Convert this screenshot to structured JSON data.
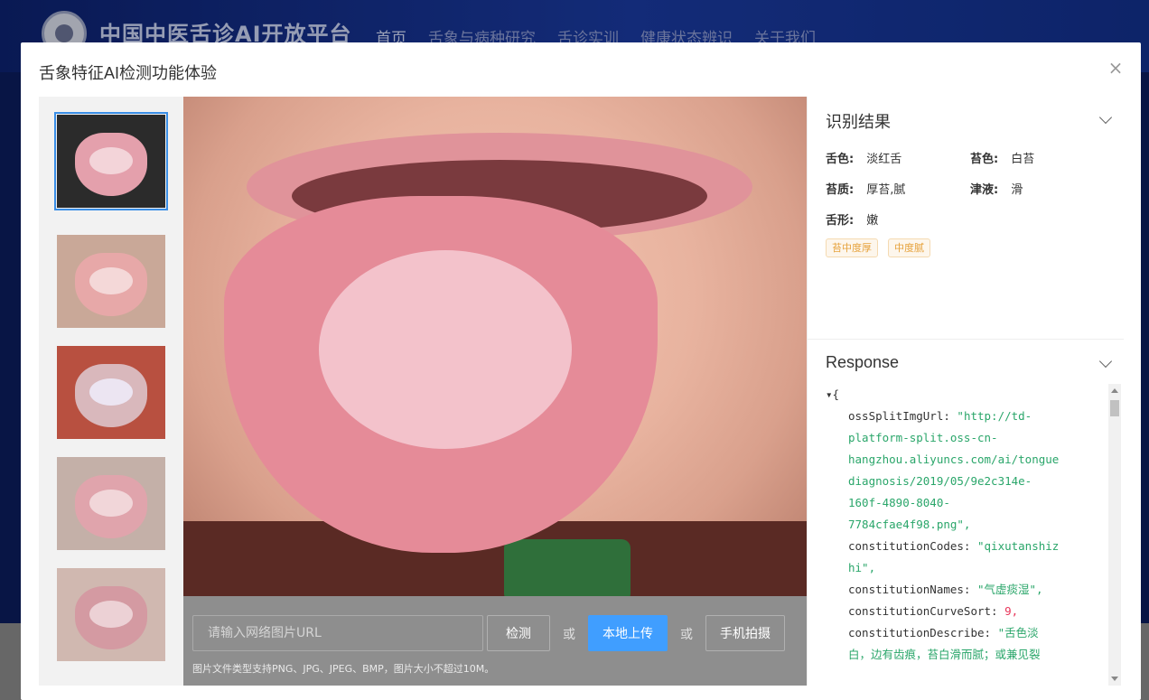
{
  "site": {
    "title": "中国中医舌诊AI开放平台",
    "nav": [
      "首页",
      "舌象与病种研究",
      "舌诊实训",
      "健康状态辨识",
      "关于我们"
    ]
  },
  "modal": {
    "title": "舌象特征AI检测功能体验",
    "close_icon": "close-icon"
  },
  "thumbnails": [
    {
      "label": "thumb-1",
      "selected": true
    },
    {
      "label": "thumb-2",
      "selected": false
    },
    {
      "label": "thumb-3",
      "selected": false
    },
    {
      "label": "thumb-4",
      "selected": false
    },
    {
      "label": "thumb-5",
      "selected": false
    }
  ],
  "controls": {
    "url_placeholder": "请输入网络图片URL",
    "detect_label": "检测",
    "or1": "或",
    "upload_label": "本地上传",
    "or2": "或",
    "phone_label": "手机拍摄",
    "hint": "图片文件类型支持PNG、JPG、JPEG、BMP，图片大小不超过10M。"
  },
  "result": {
    "header": "识别结果",
    "tongue_color_key": "舌色:",
    "tongue_color_val": "淡红舌",
    "coat_color_key": "苔色:",
    "coat_color_val": "白苔",
    "coat_quality_key": "苔质:",
    "coat_quality_val": "厚苔,腻",
    "fluid_key": "津液:",
    "fluid_val": "滑",
    "shape_key": "舌形:",
    "shape_val": "嫩",
    "tags": [
      "苔中度厚",
      "中度腻"
    ]
  },
  "response": {
    "header": "Response",
    "json_lines": [
      {
        "k": "",
        "v": "{",
        "t": "brace"
      },
      {
        "k": "ossSplitImgUrl",
        "v": "\"http://td-",
        "t": "str"
      },
      {
        "k": "",
        "v": "platform-split.oss-cn-",
        "t": "str"
      },
      {
        "k": "",
        "v": "hangzhou.aliyuncs.com/ai/tongue",
        "t": "str"
      },
      {
        "k": "",
        "v": "diagnosis/2019/05/9e2c314e-",
        "t": "str"
      },
      {
        "k": "",
        "v": "160f-4890-8040-",
        "t": "str"
      },
      {
        "k": "",
        "v": "7784cfae4f98.png\",",
        "t": "str"
      },
      {
        "k": "constitutionCodes",
        "v": "\"qixutanshiz",
        "t": "str"
      },
      {
        "k": "",
        "v": "hi\",",
        "t": "str"
      },
      {
        "k": "constitutionNames",
        "v": "\"气虚痰湿\",",
        "t": "str"
      },
      {
        "k": "constitutionCurveSort",
        "v": "9,",
        "t": "num"
      },
      {
        "k": "constitutionDescribe",
        "v": "\"舌色淡",
        "t": "str"
      },
      {
        "k": "",
        "v": "白，边有齿痕，苔白滑而腻；或兼见裂",
        "t": "str"
      }
    ]
  }
}
